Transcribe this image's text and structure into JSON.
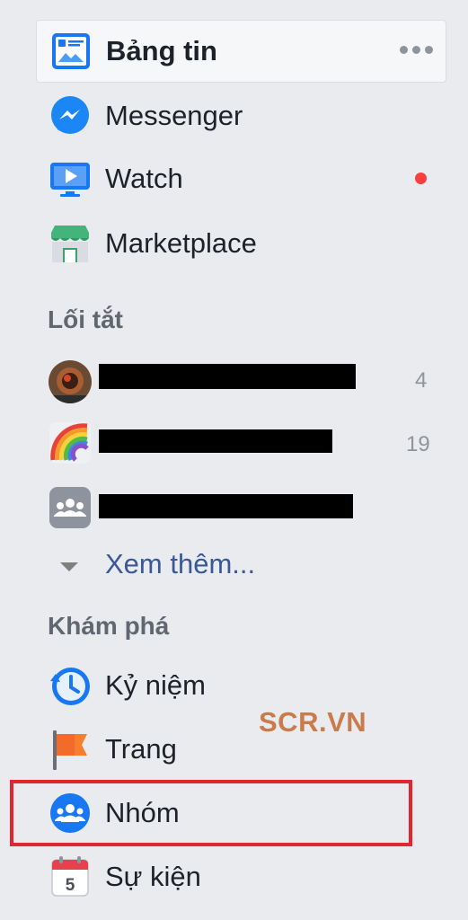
{
  "nav": {
    "news_feed": {
      "label": "Bảng tin",
      "icon": "news-feed-icon"
    },
    "messenger": {
      "label": "Messenger",
      "icon": "messenger-icon"
    },
    "watch": {
      "label": "Watch",
      "icon": "watch-icon"
    },
    "marketplace": {
      "label": "Marketplace",
      "icon": "marketplace-icon"
    }
  },
  "shortcuts": {
    "title": "Lối tắt",
    "items": [
      {
        "count": "4",
        "icon": "avatar-icon"
      },
      {
        "count": "19",
        "icon": "rainbow-icon"
      },
      {
        "count": "",
        "icon": "group-avatar-icon"
      }
    ],
    "see_more": "Xem thêm..."
  },
  "explore": {
    "title": "Khám phá",
    "items": [
      {
        "label": "Kỷ niệm",
        "icon": "memories-icon"
      },
      {
        "label": "Trang",
        "icon": "flag-icon"
      },
      {
        "label": "Nhóm",
        "icon": "groups-icon"
      },
      {
        "label": "Sự kiện",
        "icon": "calendar-icon"
      }
    ]
  },
  "calendar_day": "5",
  "watermark": "SCR.VN",
  "colors": {
    "background": "#e9ebee",
    "link": "#385898",
    "section_title": "#606770",
    "notification": "#fa3e3e",
    "highlight": "#e0262e",
    "watermark": "#c97b4b"
  }
}
